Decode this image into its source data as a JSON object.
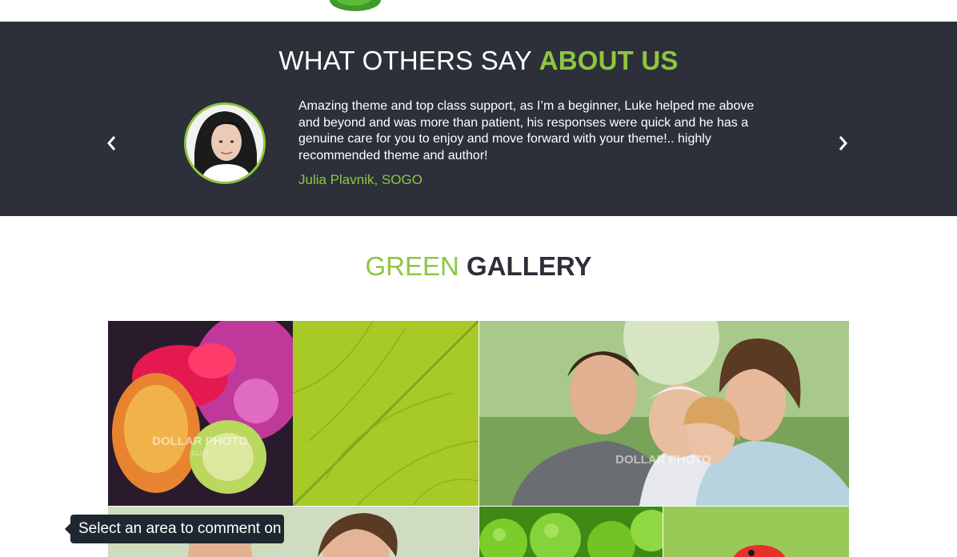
{
  "header": {
    "logo_icon": "leaf-icon"
  },
  "testimonials": {
    "title_main": "WHAT OTHERS SAY",
    "title_highlight": "ABOUT US",
    "quote": "Amazing theme and top class support, as I’m a beginner, Luke helped me above and beyond and was more than patient, his responses were quick and he has a genuine care for you to enjoy and move forward with your theme!.. highly recommended theme and author!",
    "author": "Julia Plavnik, SOGO",
    "prev_icon": "chevron-left-icon",
    "next_icon": "chevron-right-icon"
  },
  "gallery": {
    "title_green": "GREEN",
    "title_dark": "GALLERY",
    "watermark": "DOLLAR PHOTO",
    "watermark_sub": "CLUB",
    "items": [
      {
        "subject": "cactus fruit"
      },
      {
        "subject": "green leaf"
      },
      {
        "subject": "group of friends"
      },
      {
        "subject": "smiling friends"
      },
      {
        "subject": "green apples"
      },
      {
        "subject": "ladybug"
      }
    ]
  },
  "tooltip": {
    "text": "Select an area to comment on"
  },
  "colors": {
    "accent": "#8dc63f",
    "dark_band": "#2d3039",
    "tooltip_bg": "#1f2730"
  }
}
